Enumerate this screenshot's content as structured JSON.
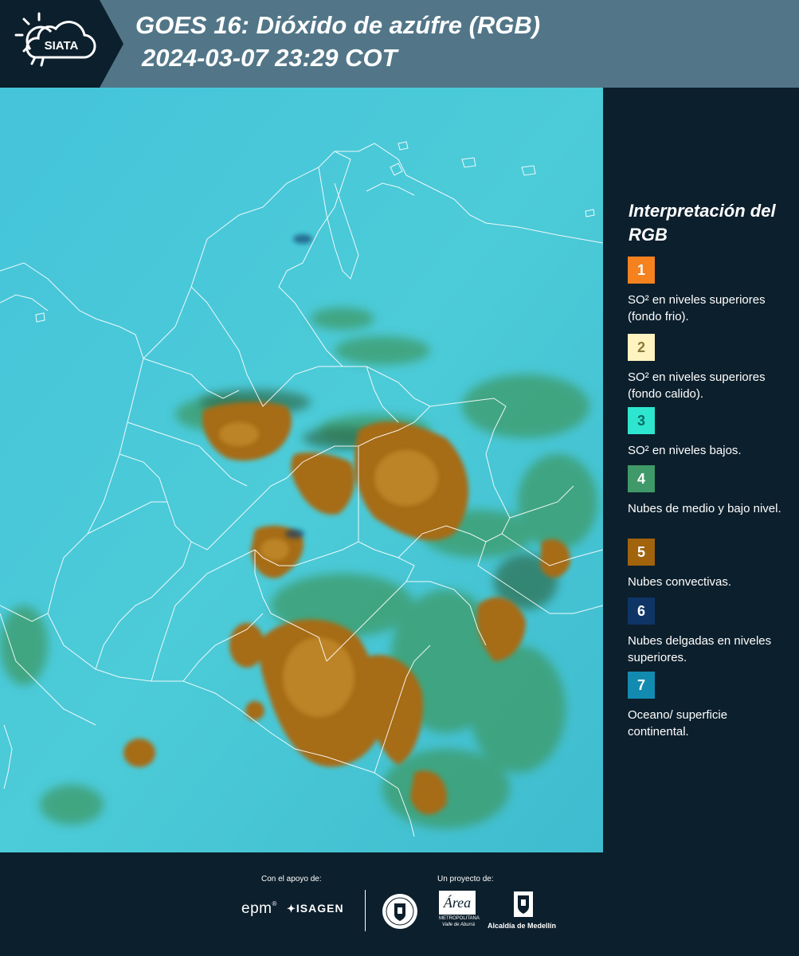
{
  "header": {
    "logo_text": "SIATA",
    "title_line1": "GOES 16: Dióxido de azúfre (RGB)",
    "title_line2": "2024-03-07 23:29 COT"
  },
  "map": {
    "layer": "goes16-so2-rgb-composite",
    "borders_color": "#ffffff"
  },
  "legend": {
    "title": "Interpretación del RGB",
    "items": [
      {
        "number": "1",
        "color": "#f5821f",
        "number_color": "#ffffff",
        "label": "SO² en niveles superiores (fondo frio)."
      },
      {
        "number": "2",
        "color": "#fff3bf",
        "number_color": "#8a7a3a",
        "label": "SO² en niveles superiores (fondo calido)."
      },
      {
        "number": "3",
        "color": "#2ee6cf",
        "number_color": "#0b6b66",
        "label": "SO² en niveles bajos."
      },
      {
        "number": "4",
        "color": "#3f9968",
        "number_color": "#ffffff",
        "label": "Nubes de medio y bajo nivel."
      },
      {
        "number": "5",
        "color": "#a1630c",
        "number_color": "#ffffff",
        "label": "Nubes convectivas."
      },
      {
        "number": "6",
        "color": "#0f3567",
        "number_color": "#ffffff",
        "label": "Nubes delgadas en niveles superiores."
      },
      {
        "number": "7",
        "color": "#138bb1",
        "number_color": "#ffffff",
        "label": "Oceano/ superficie continental."
      }
    ]
  },
  "footer": {
    "support_label": "Con el apoyo de:",
    "project_label": "Un proyecto de:",
    "sponsor_epm": "epm",
    "sponsor_isagen": "ISAGEN",
    "area_metro_name": "Área",
    "area_metro_sub1": "METROPOLITANA",
    "area_metro_sub2": "Valle de Aburrá",
    "alcaldia": "Alcaldía de Medellín"
  }
}
